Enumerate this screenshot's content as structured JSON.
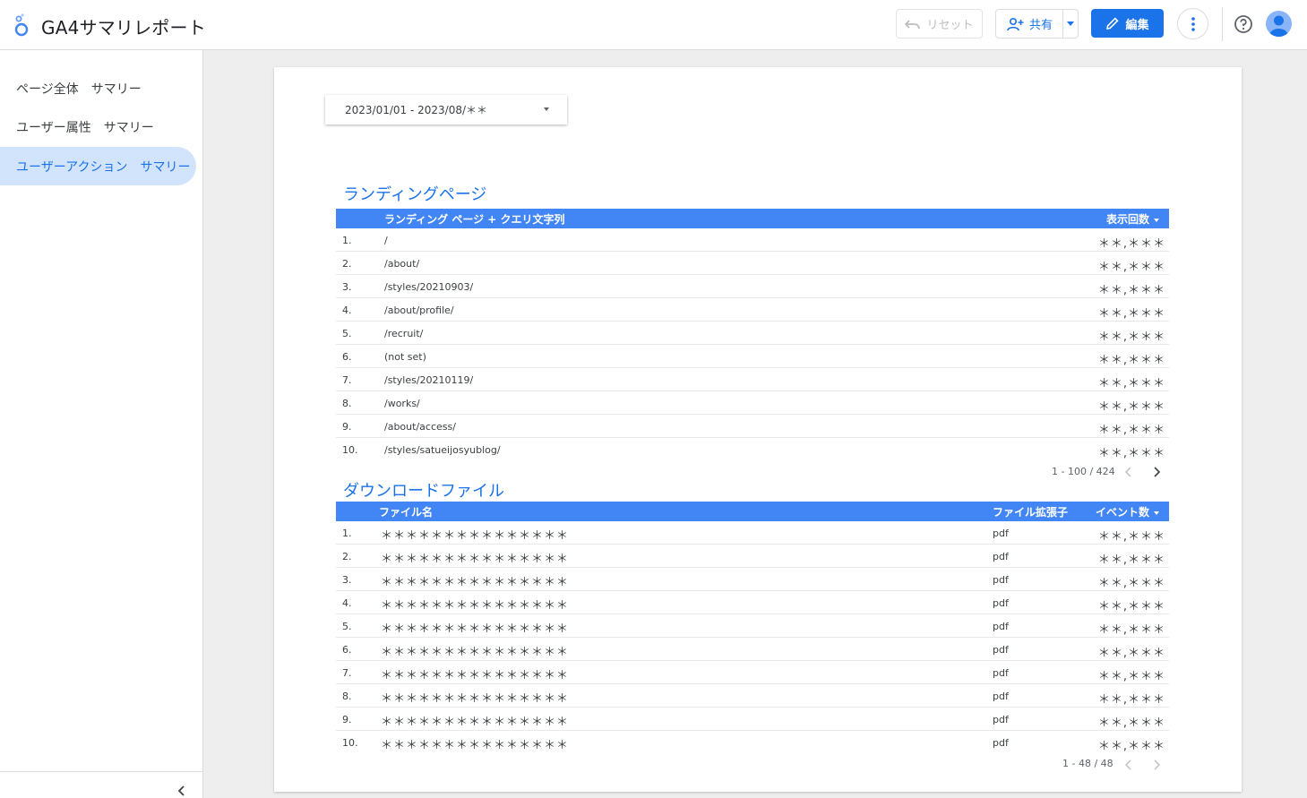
{
  "header": {
    "app_title": "GA4サマリレポート",
    "reset_label": "リセット",
    "share_label": "共有",
    "edit_label": "編集"
  },
  "sidebar": {
    "items": [
      {
        "label": "ページ全体　サマリー",
        "active": false
      },
      {
        "label": "ユーザー属性　サマリー",
        "active": false
      },
      {
        "label": "ユーザーアクション　サマリー",
        "active": true
      }
    ]
  },
  "report": {
    "date_range": "2023/01/01 - 2023/08/＊＊",
    "landing": {
      "title": "ランディングページ",
      "col_page": "ランディング ページ + クエリ文字列",
      "col_views": "表示回数",
      "rows": [
        {
          "idx": "1.",
          "page": "/",
          "views": "＊＊,＊＊＊"
        },
        {
          "idx": "2.",
          "page": "/about/",
          "views": "＊＊,＊＊＊"
        },
        {
          "idx": "3.",
          "page": "/styles/20210903/",
          "views": "＊＊,＊＊＊"
        },
        {
          "idx": "4.",
          "page": "/about/profile/",
          "views": "＊＊,＊＊＊"
        },
        {
          "idx": "5.",
          "page": "/recruit/",
          "views": "＊＊,＊＊＊"
        },
        {
          "idx": "6.",
          "page": "(not set)",
          "views": "＊＊,＊＊＊"
        },
        {
          "idx": "7.",
          "page": "/styles/20210119/",
          "views": "＊＊,＊＊＊"
        },
        {
          "idx": "8.",
          "page": "/works/",
          "views": "＊＊,＊＊＊"
        },
        {
          "idx": "9.",
          "page": "/about/access/",
          "views": "＊＊,＊＊＊"
        },
        {
          "idx": "10.",
          "page": "/styles/satueijosyublog/",
          "views": "＊＊,＊＊＊"
        }
      ],
      "pager": "1 - 100 / 424"
    },
    "downloads": {
      "title": "ダウンロードファイル",
      "col_file": "ファイル名",
      "col_ext": "ファイル拡張子",
      "col_events": "イベント数",
      "rows": [
        {
          "idx": "1.",
          "file": "＊＊＊＊＊＊＊＊＊＊＊＊＊＊＊",
          "ext": "pdf",
          "events": "＊＊,＊＊＊"
        },
        {
          "idx": "2.",
          "file": "＊＊＊＊＊＊＊＊＊＊＊＊＊＊＊",
          "ext": "pdf",
          "events": "＊＊,＊＊＊"
        },
        {
          "idx": "3.",
          "file": "＊＊＊＊＊＊＊＊＊＊＊＊＊＊＊",
          "ext": "pdf",
          "events": "＊＊,＊＊＊"
        },
        {
          "idx": "4.",
          "file": "＊＊＊＊＊＊＊＊＊＊＊＊＊＊＊",
          "ext": "pdf",
          "events": "＊＊,＊＊＊"
        },
        {
          "idx": "5.",
          "file": "＊＊＊＊＊＊＊＊＊＊＊＊＊＊＊",
          "ext": "pdf",
          "events": "＊＊,＊＊＊"
        },
        {
          "idx": "6.",
          "file": "＊＊＊＊＊＊＊＊＊＊＊＊＊＊＊",
          "ext": "pdf",
          "events": "＊＊,＊＊＊"
        },
        {
          "idx": "7.",
          "file": "＊＊＊＊＊＊＊＊＊＊＊＊＊＊＊",
          "ext": "pdf",
          "events": "＊＊,＊＊＊"
        },
        {
          "idx": "8.",
          "file": "＊＊＊＊＊＊＊＊＊＊＊＊＊＊＊",
          "ext": "pdf",
          "events": "＊＊,＊＊＊"
        },
        {
          "idx": "9.",
          "file": "＊＊＊＊＊＊＊＊＊＊＊＊＊＊＊",
          "ext": "pdf",
          "events": "＊＊,＊＊＊"
        },
        {
          "idx": "10.",
          "file": "＊＊＊＊＊＊＊＊＊＊＊＊＊＊＊",
          "ext": "pdf",
          "events": "＊＊,＊＊＊"
        }
      ],
      "pager": "1 - 48 / 48"
    }
  },
  "icons": {
    "logo": "looker-studio-logo-icon",
    "reset": "undo-icon",
    "share": "person-add-icon",
    "share_dropdown": "caret-down-icon",
    "edit": "pencil-icon",
    "more": "more-vert-icon",
    "help": "help-icon",
    "avatar": "avatar",
    "collapse": "chevron-left-icon",
    "prev": "chevron-left-icon",
    "next": "chevron-right-icon"
  },
  "colors": {
    "accent": "#1a73e8",
    "table_header": "#4285f4",
    "nav_active_bg": "#d2e3fc"
  }
}
